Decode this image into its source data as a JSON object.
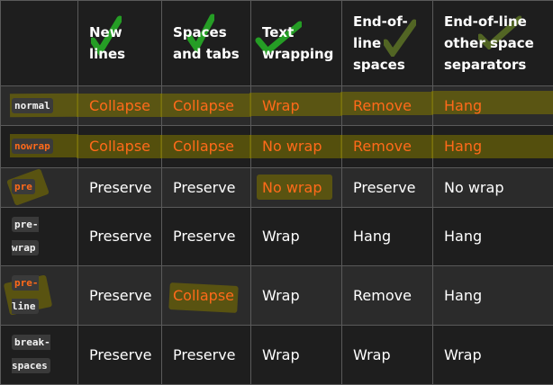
{
  "headers": [
    "",
    "New lines",
    "Spaces and tabs",
    "Text wrapping",
    "End-of-line spaces",
    "End-of-line other space separators"
  ],
  "header_lines": [
    [],
    [
      "New",
      "lines"
    ],
    [
      "Spaces",
      "and tabs"
    ],
    [
      "Text",
      "wrapping"
    ],
    [
      "End-of-",
      "line",
      "spaces"
    ],
    [
      "End-of-line",
      "other space",
      "separators"
    ]
  ],
  "rows": [
    {
      "value": "normal",
      "value_lines": [
        "normal"
      ],
      "cells": [
        "Collapse",
        "Collapse",
        "Wrap",
        "Remove",
        "Hang"
      ]
    },
    {
      "value": "nowrap",
      "value_lines": [
        "nowrap"
      ],
      "cells": [
        "Collapse",
        "Collapse",
        "No wrap",
        "Remove",
        "Hang"
      ]
    },
    {
      "value": "pre",
      "value_lines": [
        "pre"
      ],
      "cells": [
        "Preserve",
        "Preserve",
        "No wrap",
        "Preserve",
        "No wrap"
      ]
    },
    {
      "value": "pre-wrap",
      "value_lines": [
        "pre-",
        "wrap"
      ],
      "cells": [
        "Preserve",
        "Preserve",
        "Wrap",
        "Hang",
        "Hang"
      ]
    },
    {
      "value": "pre-line",
      "value_lines": [
        "pre-",
        "line"
      ],
      "cells": [
        "Preserve",
        "Collapse",
        "Wrap",
        "Remove",
        "Hang"
      ]
    },
    {
      "value": "break-spaces",
      "value_lines": [
        "break-",
        "spaces"
      ],
      "cells": [
        "Preserve",
        "Preserve",
        "Wrap",
        "Wrap",
        "Wrap"
      ]
    }
  ],
  "colors": {
    "highlight_text": "#ff6a1a",
    "highlighter": "#827800",
    "checkmark": "#22cc22",
    "border": "#5a5a5a"
  }
}
